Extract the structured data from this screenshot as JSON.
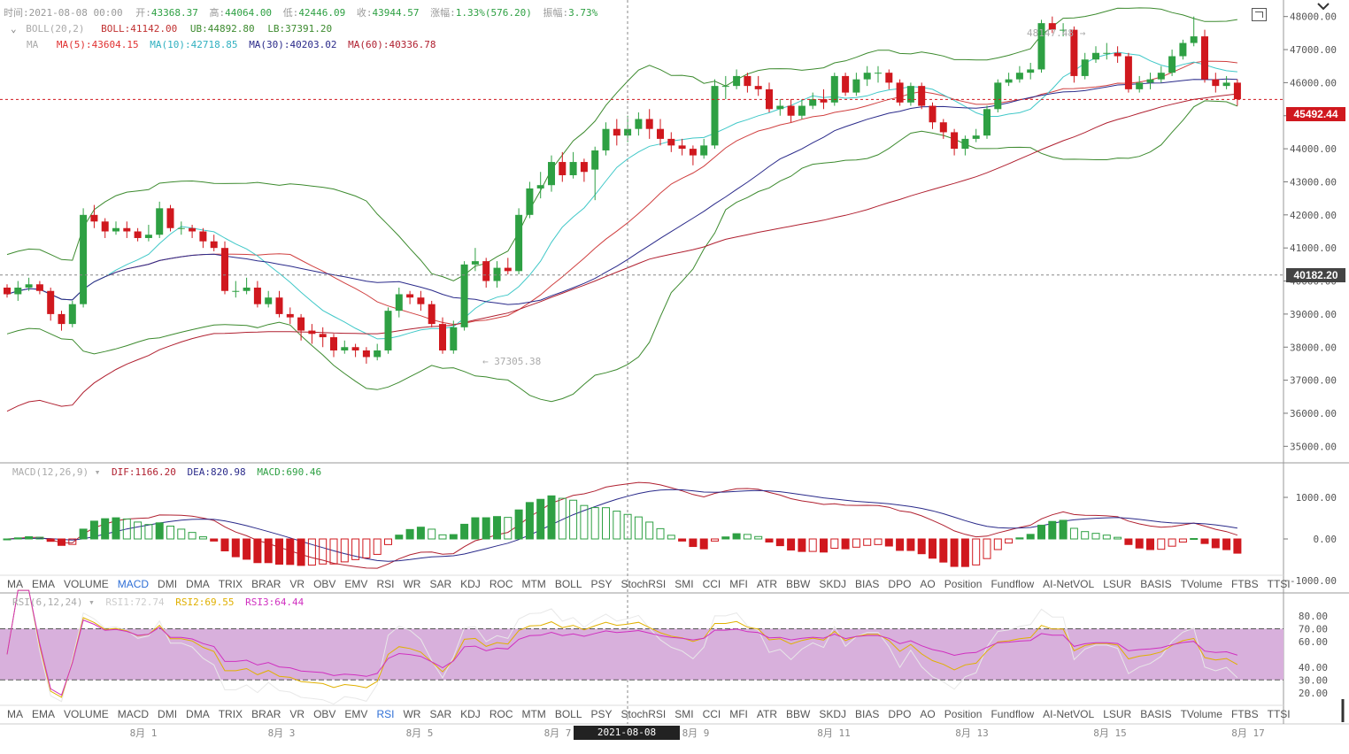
{
  "header": {
    "time_label": "时间:",
    "time_value": "2021-08-08 00:00",
    "open_label": "开:",
    "open_value": "43368.37",
    "high_label": "高:",
    "high_value": "44064.00",
    "low_label": "低:",
    "low_value": "42446.09",
    "close_label": "收:",
    "close_value": "43944.57",
    "change_label": "涨幅:",
    "change_value": "1.33%(576.20)",
    "amp_label": "振幅:",
    "amp_value": "3.73%"
  },
  "boll": {
    "name": "BOLL(20,2)",
    "boll": "BOLL:41142.00",
    "ub": "UB:44892.80",
    "lb": "LB:37391.20"
  },
  "ma": {
    "name": "MA",
    "ma5": "MA(5):43604.15",
    "ma10": "MA(10):42718.85",
    "ma30": "MA(30):40203.02",
    "ma60": "MA(60):40336.78"
  },
  "macd": {
    "name": "MACD(12,26,9)",
    "dif": "DIF:1166.20",
    "dea": "DEA:820.98",
    "macd": "MACD:690.46",
    "axis": [
      "1000.00",
      "0.00",
      "-1000.00"
    ]
  },
  "rsi": {
    "name": "RSI(6,12,24)",
    "rsi1": "RSI1:72.74",
    "rsi2": "RSI2:69.55",
    "rsi3": "RSI3:64.44",
    "axis": [
      "80.00",
      "70.00",
      "60.00",
      "40.00",
      "30.00",
      "20.00"
    ]
  },
  "price_axis": [
    "48000.00",
    "47000.00",
    "46000.00",
    "45000.00",
    "44000.00",
    "43000.00",
    "42000.00",
    "41000.00",
    "40000.00",
    "39000.00",
    "38000.00",
    "37000.00",
    "36000.00",
    "35000.00"
  ],
  "price_tags": {
    "current": "45492.44",
    "cursor": "40182.20"
  },
  "annotations": {
    "high": "48147.48",
    "low": "37305.38"
  },
  "x_axis": [
    "8月 1",
    "8月 3",
    "8月 5",
    "8月 7",
    "8月 9",
    "8月 11",
    "8月 13",
    "8月 15",
    "8月 17"
  ],
  "cursor_time": "2021-08-08 00:00:00",
  "indicator_tabs": [
    "MA",
    "EMA",
    "VOLUME",
    "MACD",
    "DMI",
    "DMA",
    "TRIX",
    "BRAR",
    "VR",
    "OBV",
    "EMV",
    "RSI",
    "WR",
    "SAR",
    "KDJ",
    "ROC",
    "MTM",
    "BOLL",
    "PSY",
    "StochRSI",
    "SMI",
    "CCI",
    "MFI",
    "ATR",
    "BBW",
    "SKDJ",
    "BIAS",
    "DPO",
    "AO",
    "Position",
    "Fundflow",
    "AI-NetVOL",
    "LSUR",
    "BASIS",
    "TVolume",
    "FTBS",
    "TTSI"
  ],
  "active_tab_top": "MACD",
  "active_tab_bottom": "RSI",
  "colors": {
    "up": "#2ea043",
    "down": "#d0181e",
    "boll": "#3c8a2e",
    "ma5": "#e03030",
    "ma10": "#40c8c8",
    "ma30": "#2a2a8a",
    "ma60": "#b02030",
    "rsi_band": "#d8b0dc"
  },
  "chart_data": {
    "type": "candlestick",
    "interval": "4h",
    "ylim": [
      34500,
      48500
    ],
    "candles": [
      [
        39800,
        39600,
        39900,
        39500
      ],
      [
        39600,
        39800,
        40000,
        39400
      ],
      [
        39800,
        39900,
        40100,
        39700
      ],
      [
        39900,
        39700,
        40000,
        39600
      ],
      [
        39700,
        39000,
        39800,
        38800
      ],
      [
        39000,
        38700,
        39100,
        38500
      ],
      [
        38700,
        39300,
        39400,
        38600
      ],
      [
        39300,
        42000,
        42200,
        39200
      ],
      [
        42000,
        41800,
        42300,
        41600
      ],
      [
        41800,
        41500,
        41900,
        41300
      ],
      [
        41500,
        41600,
        41800,
        41400
      ],
      [
        41600,
        41500,
        41800,
        41300
      ],
      [
        41500,
        41300,
        41600,
        41200
      ],
      [
        41300,
        41400,
        41700,
        41200
      ],
      [
        41400,
        42200,
        42400,
        41300
      ],
      [
        42200,
        41600,
        42300,
        41500
      ],
      [
        41600,
        41600,
        41800,
        41400
      ],
      [
        41600,
        41500,
        41700,
        41300
      ],
      [
        41500,
        41200,
        41600,
        41000
      ],
      [
        41200,
        41000,
        41400,
        40900
      ],
      [
        41000,
        39700,
        41200,
        39600
      ],
      [
        39700,
        39700,
        40000,
        39500
      ],
      [
        39700,
        39800,
        40100,
        39600
      ],
      [
        39800,
        39300,
        40000,
        39200
      ],
      [
        39300,
        39500,
        39700,
        39200
      ],
      [
        39500,
        39000,
        39700,
        38900
      ],
      [
        39000,
        38900,
        39200,
        38700
      ],
      [
        38900,
        38500,
        39000,
        38200
      ],
      [
        38500,
        38400,
        38700,
        38100
      ],
      [
        38400,
        38300,
        38600,
        38000
      ],
      [
        38300,
        37900,
        38400,
        37700
      ],
      [
        37900,
        38000,
        38200,
        37800
      ],
      [
        38000,
        37900,
        38100,
        37700
      ],
      [
        37900,
        37700,
        38000,
        37500
      ],
      [
        37700,
        37900,
        38100,
        37600
      ],
      [
        37900,
        39100,
        39200,
        37800
      ],
      [
        39100,
        39600,
        39800,
        38900
      ],
      [
        39600,
        39500,
        39700,
        39300
      ],
      [
        39500,
        39300,
        39700,
        39100
      ],
      [
        39300,
        38700,
        39400,
        38600
      ],
      [
        38700,
        37900,
        38900,
        37800
      ],
      [
        37900,
        38600,
        38800,
        37800
      ],
      [
        38600,
        40500,
        40600,
        38500
      ],
      [
        40500,
        40600,
        41000,
        40300
      ],
      [
        40600,
        40000,
        40700,
        39800
      ],
      [
        40000,
        40400,
        40600,
        39800
      ],
      [
        40400,
        40300,
        40700,
        40200
      ],
      [
        40300,
        42000,
        42200,
        40200
      ],
      [
        42000,
        42800,
        43000,
        41900
      ],
      [
        42800,
        42900,
        43300,
        42500
      ],
      [
        42900,
        43600,
        43800,
        42700
      ],
      [
        43600,
        43200,
        43900,
        43000
      ],
      [
        43200,
        43600,
        43900,
        43100
      ],
      [
        43600,
        43300,
        43700,
        43000
      ],
      [
        43370,
        43950,
        44064,
        42446
      ],
      [
        43950,
        44600,
        44800,
        43800
      ],
      [
        44600,
        44400,
        44900,
        44100
      ],
      [
        44400,
        44600,
        45000,
        44200
      ],
      [
        44600,
        44900,
        45100,
        44400
      ],
      [
        44900,
        44600,
        45200,
        44300
      ],
      [
        44600,
        44300,
        44900,
        44100
      ],
      [
        44300,
        44100,
        44500,
        43900
      ],
      [
        44100,
        44000,
        44300,
        43800
      ],
      [
        44000,
        43800,
        44100,
        43500
      ],
      [
        43800,
        44100,
        44300,
        43700
      ],
      [
        44100,
        45900,
        46100,
        44000
      ],
      [
        45900,
        45900,
        46200,
        45500
      ],
      [
        45900,
        46200,
        46400,
        45800
      ],
      [
        46200,
        45900,
        46300,
        45700
      ],
      [
        45900,
        45800,
        46200,
        45600
      ],
      [
        45800,
        45200,
        46000,
        45100
      ],
      [
        45200,
        45300,
        45500,
        45000
      ],
      [
        45300,
        45000,
        45500,
        44800
      ],
      [
        45000,
        45300,
        45500,
        44900
      ],
      [
        45300,
        45500,
        45700,
        45200
      ],
      [
        45500,
        45400,
        45800,
        45200
      ],
      [
        45400,
        46200,
        46300,
        45300
      ],
      [
        46200,
        45700,
        46300,
        45600
      ],
      [
        45700,
        46100,
        46300,
        45600
      ],
      [
        46100,
        46300,
        46500,
        45900
      ],
      [
        46300,
        46300,
        46500,
        46000
      ],
      [
        46300,
        46000,
        46400,
        45800
      ],
      [
        46000,
        45400,
        46100,
        45300
      ],
      [
        45400,
        45900,
        46000,
        45300
      ],
      [
        45900,
        45300,
        46000,
        45200
      ],
      [
        45300,
        44800,
        45400,
        44600
      ],
      [
        44800,
        44500,
        44900,
        44300
      ],
      [
        44500,
        44000,
        44600,
        43800
      ],
      [
        44000,
        44300,
        44400,
        43800
      ],
      [
        44300,
        44400,
        44600,
        44200
      ],
      [
        44400,
        45200,
        45300,
        44300
      ],
      [
        45200,
        46000,
        46100,
        45100
      ],
      [
        46000,
        46100,
        46300,
        45900
      ],
      [
        46100,
        46300,
        46500,
        46000
      ],
      [
        46300,
        46400,
        46600,
        46100
      ],
      [
        46400,
        47800,
        47900,
        46300
      ],
      [
        47800,
        47600,
        48000,
        47500
      ],
      [
        47600,
        47600,
        47800,
        47400
      ],
      [
        47600,
        46200,
        47700,
        46000
      ],
      [
        46200,
        46700,
        46900,
        46100
      ],
      [
        46700,
        46900,
        47100,
        46600
      ],
      [
        46900,
        46900,
        47200,
        46700
      ],
      [
        46900,
        46800,
        47100,
        46600
      ],
      [
        46800,
        45800,
        46900,
        45700
      ],
      [
        45800,
        46000,
        46200,
        45700
      ],
      [
        46000,
        46100,
        46300,
        45800
      ],
      [
        46100,
        46300,
        46500,
        46000
      ],
      [
        46300,
        46800,
        47000,
        46200
      ],
      [
        46800,
        47200,
        47300,
        46700
      ],
      [
        47200,
        47400,
        48000,
        47100
      ],
      [
        47400,
        46100,
        47600,
        46000
      ],
      [
        46100,
        45900,
        46300,
        45700
      ],
      [
        45900,
        46000,
        46200,
        45800
      ],
      [
        46000,
        45500,
        46100,
        45300
      ]
    ]
  }
}
